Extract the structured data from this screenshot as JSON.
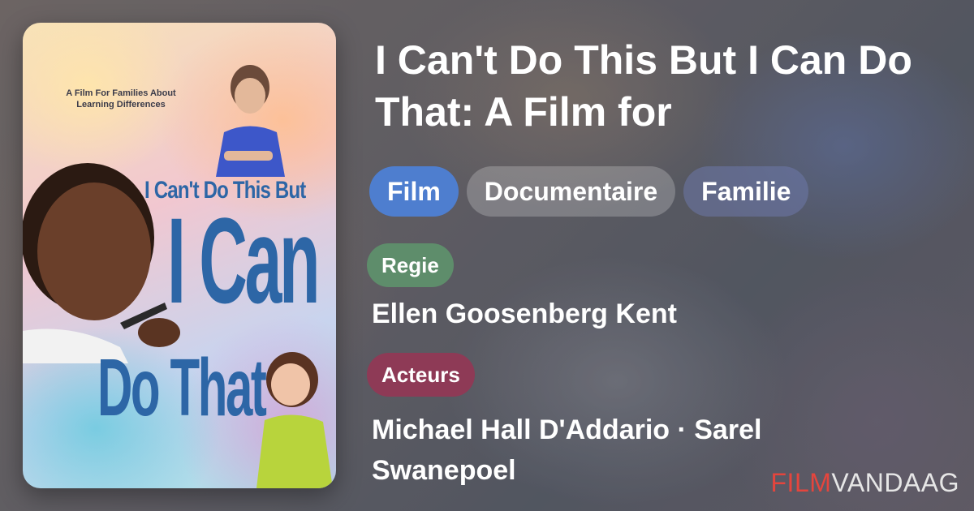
{
  "film": {
    "title": "I Can't Do This But I Can Do That: A Film for",
    "genres": [
      "Film",
      "Documentaire",
      "Familie"
    ],
    "director_label": "Regie",
    "director": "Ellen Goosenberg Kent",
    "actors_label": "Acteurs",
    "actors": "Michael Hall D'Addario · Sarel Swanepoel"
  },
  "poster": {
    "tagline": "A Film For Families About Learning Differences",
    "title_line1": "I Can't Do This But",
    "title_big": "I Can",
    "title_do": "Do That"
  },
  "brand": {
    "part1": "FILM",
    "part2": "VANDAAG"
  },
  "colors": {
    "chip_primary": "#4e7ecf",
    "regie_badge": "#5e8d6b",
    "acteurs_badge": "#8e3a56",
    "brand_accent": "#e4453d"
  }
}
